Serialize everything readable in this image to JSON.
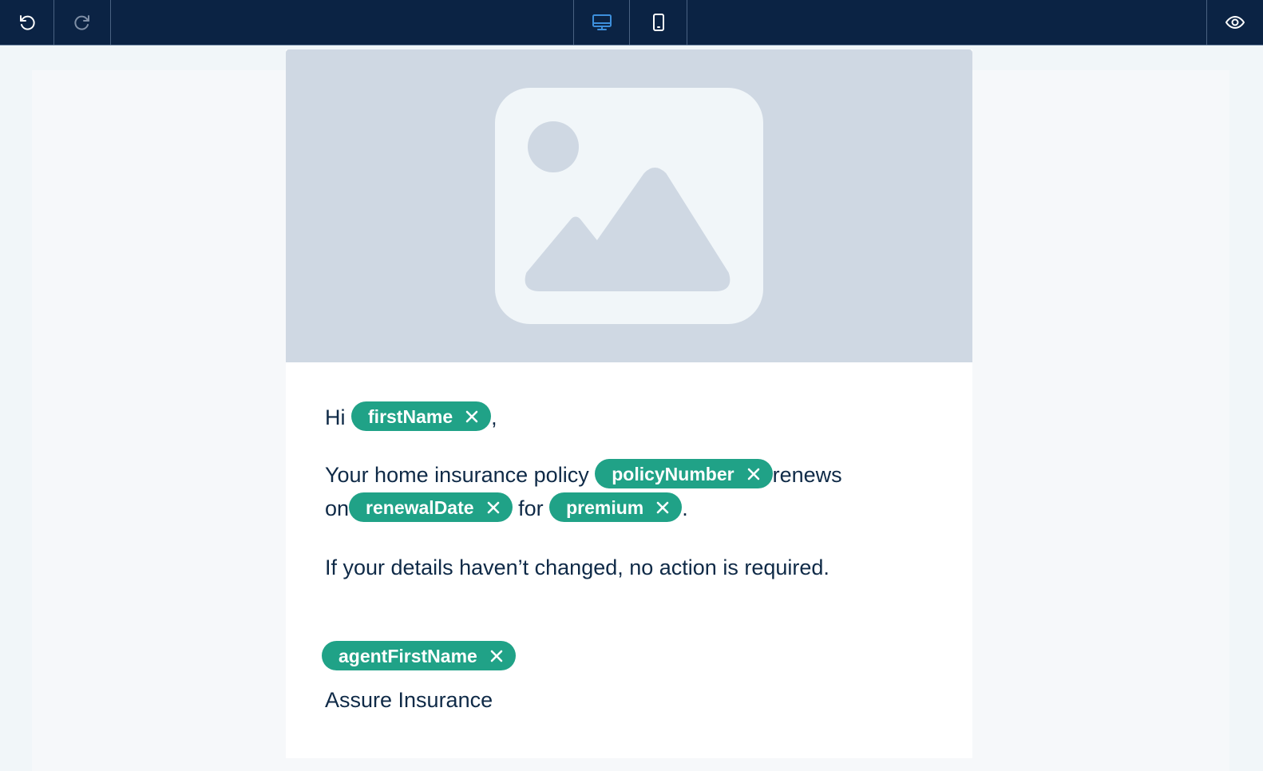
{
  "toolbar": {
    "buttons": [
      {
        "name": "undo",
        "icon": "undo-icon"
      },
      {
        "name": "redo",
        "icon": "redo-icon"
      },
      {
        "name": "desktop-view",
        "icon": "desktop-icon",
        "active": true
      },
      {
        "name": "mobile-view",
        "icon": "mobile-icon"
      },
      {
        "name": "preview",
        "icon": "eye-icon"
      }
    ]
  },
  "hero": {
    "icon": "image-placeholder-icon"
  },
  "email": {
    "greeting_prefix": "Hi",
    "greeting_var": "firstName",
    "greeting_suffix": ",",
    "policy_prefix": "Your home insurance policy",
    "policy_var": "policyNumber",
    "renews_text": "renews",
    "on_text": "on",
    "renewal_var": "renewalDate",
    "for_text": "for",
    "premium_var": "premium",
    "period": ".",
    "details_text": "If your details haven’t changed, no action is required.",
    "agent_var": "agentFirstName",
    "company_text": "Assure Insurance"
  },
  "colors": {
    "toolbar_bg": "#0b2344",
    "active_icon": "#3d8fdc",
    "pill_bg": "#20a287",
    "hero_bg": "#cfd8e3",
    "text": "#0f2a47"
  }
}
